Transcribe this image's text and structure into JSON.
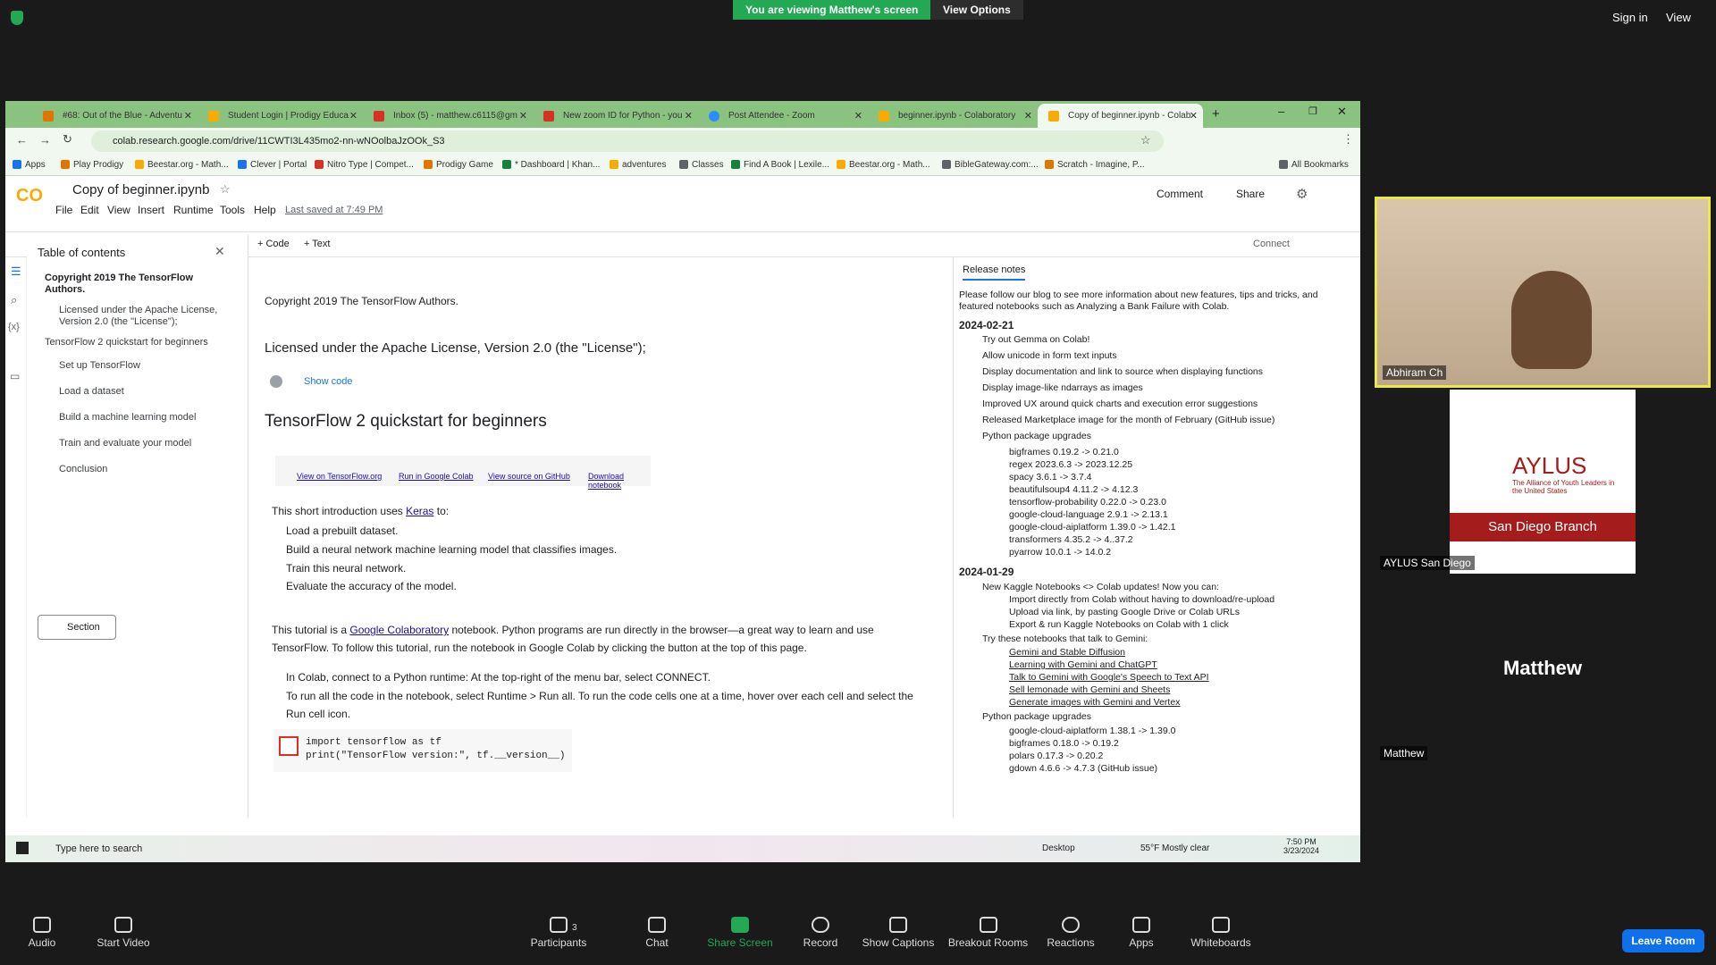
{
  "zoom": {
    "banner": "You are viewing Matthew's screen",
    "view_options": "View Options",
    "sign_in": "Sign in",
    "view": "View",
    "leave": "Leave Room",
    "participants_count": "3",
    "toolbar": [
      "Audio",
      "Start Video",
      "Participants",
      "Chat",
      "Share Screen",
      "Record",
      "Show Captions",
      "Breakout Rooms",
      "Reactions",
      "Apps",
      "Whiteboards"
    ],
    "tiles": [
      "Abhiram Ch",
      "AYLUS San Diego",
      "Matthew"
    ],
    "tile_big_name": "Matthew",
    "aylus_title": "AYLUS",
    "aylus_sub": "The Alliance of Youth Leaders in the United States",
    "aylus_branch": "San Diego Branch",
    "green": "#23a954",
    "leave_color": "#0e71eb"
  },
  "browser": {
    "tabs": [
      "#68: Out of the Blue - Adventu",
      "Student Login | Prodigy Educa",
      "Inbox (5) - matthew.c6115@gm",
      "New zoom ID for Python - you",
      "Post Attendee - Zoom",
      "beginner.ipynb - Colaboratory",
      "Copy of beginner.ipynb - Colab"
    ],
    "url": "colab.research.google.com/drive/11CWTI3L435mo2-nn-wNOolbaJzOOk_S3",
    "bookmarks": [
      "Apps",
      "Play Prodigy",
      "Beestar.org - Math...",
      "Clever | Portal",
      "Nitro Type | Compet...",
      "Prodigy Game",
      "* Dashboard | Khan...",
      "adventures",
      "Classes",
      "Find A Book | Lexile...",
      "Beestar.org - Math...",
      "BibleGateway.com:...",
      "Scratch - Imagine, P...",
      "All Bookmarks"
    ]
  },
  "colab": {
    "title": "Copy of beginner.ipynb",
    "menu": [
      "File",
      "Edit",
      "View",
      "Insert",
      "Runtime",
      "Tools",
      "Help"
    ],
    "last_saved": "Last saved at 7:49 PM",
    "comment": "Comment",
    "share": "Share",
    "add_code": "+ Code",
    "add_text": "+ Text",
    "connect": "Connect",
    "toc_title": "Table of contents",
    "toc": [
      "Copyright 2019 The TensorFlow Authors.",
      "Licensed under the Apache License, Version 2.0 (the \"License\");",
      "TensorFlow 2 quickstart for beginners",
      "Set up TensorFlow",
      "Load a dataset",
      "Build a machine learning model",
      "Train and evaluate your model",
      "Conclusion"
    ],
    "toc_section": "Section"
  },
  "notebook": {
    "h_copyright": "Copyright 2019 The TensorFlow Authors.",
    "h_license": "Licensed under the Apache License, Version 2.0 (the \"License\");",
    "show_code": "Show code",
    "h_quickstart": "TensorFlow 2 quickstart for beginners",
    "buttons": [
      "View on TensorFlow.org",
      "Run in Google Colab",
      "View source on GitHub",
      "Download notebook"
    ],
    "intro_pre": "This short introduction uses ",
    "intro_link": "Keras",
    "intro_post": " to:",
    "steps": [
      "Load a prebuilt dataset.",
      "Build a neural network machine learning model that classifies images.",
      "Train this neural network.",
      "Evaluate the accuracy of the model."
    ],
    "tutorial_pre": "This tutorial is a ",
    "tutorial_link": "Google Colaboratory",
    "tutorial_post": " notebook. Python programs are run directly in the browser—a great way to learn and use TensorFlow. To follow this tutorial, run the notebook in Google Colab by clicking the button at the top of this page.",
    "run1": "In Colab, connect to a Python runtime: At the top-right of the menu bar, select CONNECT.",
    "run2": "To run all the code in the notebook, select Runtime > Run all. To run the code cells one at a time, hover over each cell and select the Run cell icon.",
    "code1": "import tensorflow as tf",
    "code2": "print(\"TensorFlow version:\", tf.__version__)"
  },
  "release": {
    "tab": "Release notes",
    "intro": "Please follow our blog to see more information about new features, tips and tricks, and featured notebooks such as Analyzing a Bank Failure with Colab.",
    "d1": "2024-02-21",
    "items1": [
      "Try out Gemma on Colab!",
      "Allow unicode in form text inputs",
      "Display documentation and link to source when displaying functions",
      "Display image-like ndarrays as images",
      "Improved UX around quick charts and execution error suggestions",
      "Released Marketplace image for the month of February (GitHub issue)",
      "Python package upgrades"
    ],
    "pkgs1": [
      "bigframes 0.19.2 -> 0.21.0",
      "regex 2023.6.3 -> 2023.12.25",
      "spacy 3.6.1 -> 3.7.4",
      "beautifulsoup4 4.11.2 -> 4.12.3",
      "tensorflow-probability 0.22.0 -> 0.23.0",
      "google-cloud-language 2.9.1 -> 2.13.1",
      "google-cloud-aiplatform 1.39.0 -> 1.42.1",
      "transformers 4.35.2 -> 4..37.2",
      "pyarrow 10.0.1 -> 14.0.2"
    ],
    "d2": "2024-01-29",
    "items2a": "New Kaggle Notebooks <> Colab updates! Now you can:",
    "sub2a": [
      "Import directly from Colab without having to download/re-upload",
      "Upload via link, by pasting Google Drive or Colab URLs",
      "Export & run Kaggle Notebooks on Colab with 1 click"
    ],
    "items2b": "Try these notebooks that talk to Gemini:",
    "sub2b": [
      "Gemini and Stable Diffusion",
      "Learning with Gemini and ChatGPT",
      "Talk to Gemini with Google's Speech to Text API",
      "Sell lemonade with Gemini and Sheets",
      "Generate images with Gemini and Vertex"
    ],
    "items2c": "Python package upgrades",
    "pkgs2": [
      "google-cloud-aiplatform 1.38.1 -> 1.39.0",
      "bigframes 0.18.0 -> 0.19.2",
      "polars 0.17.3 -> 0.20.2",
      "gdown 4.6.6 -> 4.7.3 (GitHub issue)"
    ]
  },
  "taskbar": {
    "search": "Type here to search",
    "desktop": "Desktop",
    "weather": "55°F  Mostly clear",
    "time": "7:50 PM",
    "date": "3/23/2024"
  }
}
